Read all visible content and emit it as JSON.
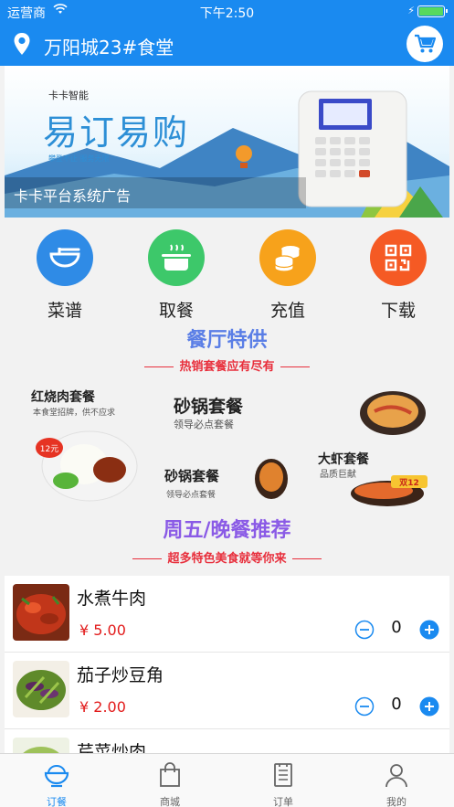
{
  "status_bar": {
    "carrier": "运营商",
    "time": "下午2:50"
  },
  "header": {
    "title": "万阳城23#食堂"
  },
  "banner": {
    "brand": "卡卡智能",
    "slogan": "易订易购",
    "tagline": "攀登不止 服务无限",
    "caption": "卡卡平台系统广告"
  },
  "menu": {
    "items": [
      {
        "label": "菜谱",
        "color": "#2f8be6"
      },
      {
        "label": "取餐",
        "color": "#3dc86a"
      },
      {
        "label": "充值",
        "color": "#f7a21b"
      },
      {
        "label": "下载",
        "color": "#f55a24"
      }
    ]
  },
  "promo1": {
    "title": "餐厅特供",
    "subtitle": "热销套餐应有尽有",
    "deals": [
      {
        "name": "红烧肉套餐",
        "desc": "本食堂招牌，供不应求",
        "badge": "12元"
      },
      {
        "name": "砂锅套餐",
        "desc": "领导必点套餐"
      },
      {
        "name": "砂锅套餐",
        "desc": "领导必点套餐"
      },
      {
        "name": "大虾套餐",
        "desc": "品质巨献",
        "badge": "双12"
      }
    ]
  },
  "promo2": {
    "title": "周五/晚餐推荐",
    "subtitle": "超多特色美食就等你来"
  },
  "dishes": [
    {
      "name": "水煮牛肉",
      "price": "¥ 5.00",
      "qty": "0"
    },
    {
      "name": "茄子炒豆角",
      "price": "¥ 2.00",
      "qty": "0"
    },
    {
      "name": "芹菜炒肉"
    }
  ],
  "tabbar": {
    "tabs": [
      {
        "label": "订餐",
        "active": true
      },
      {
        "label": "商城"
      },
      {
        "label": "订单"
      },
      {
        "label": "我的"
      }
    ]
  },
  "colors": {
    "primary": "#1a8af0",
    "price": "#e21b1b",
    "promo_red": "#e8303d"
  }
}
